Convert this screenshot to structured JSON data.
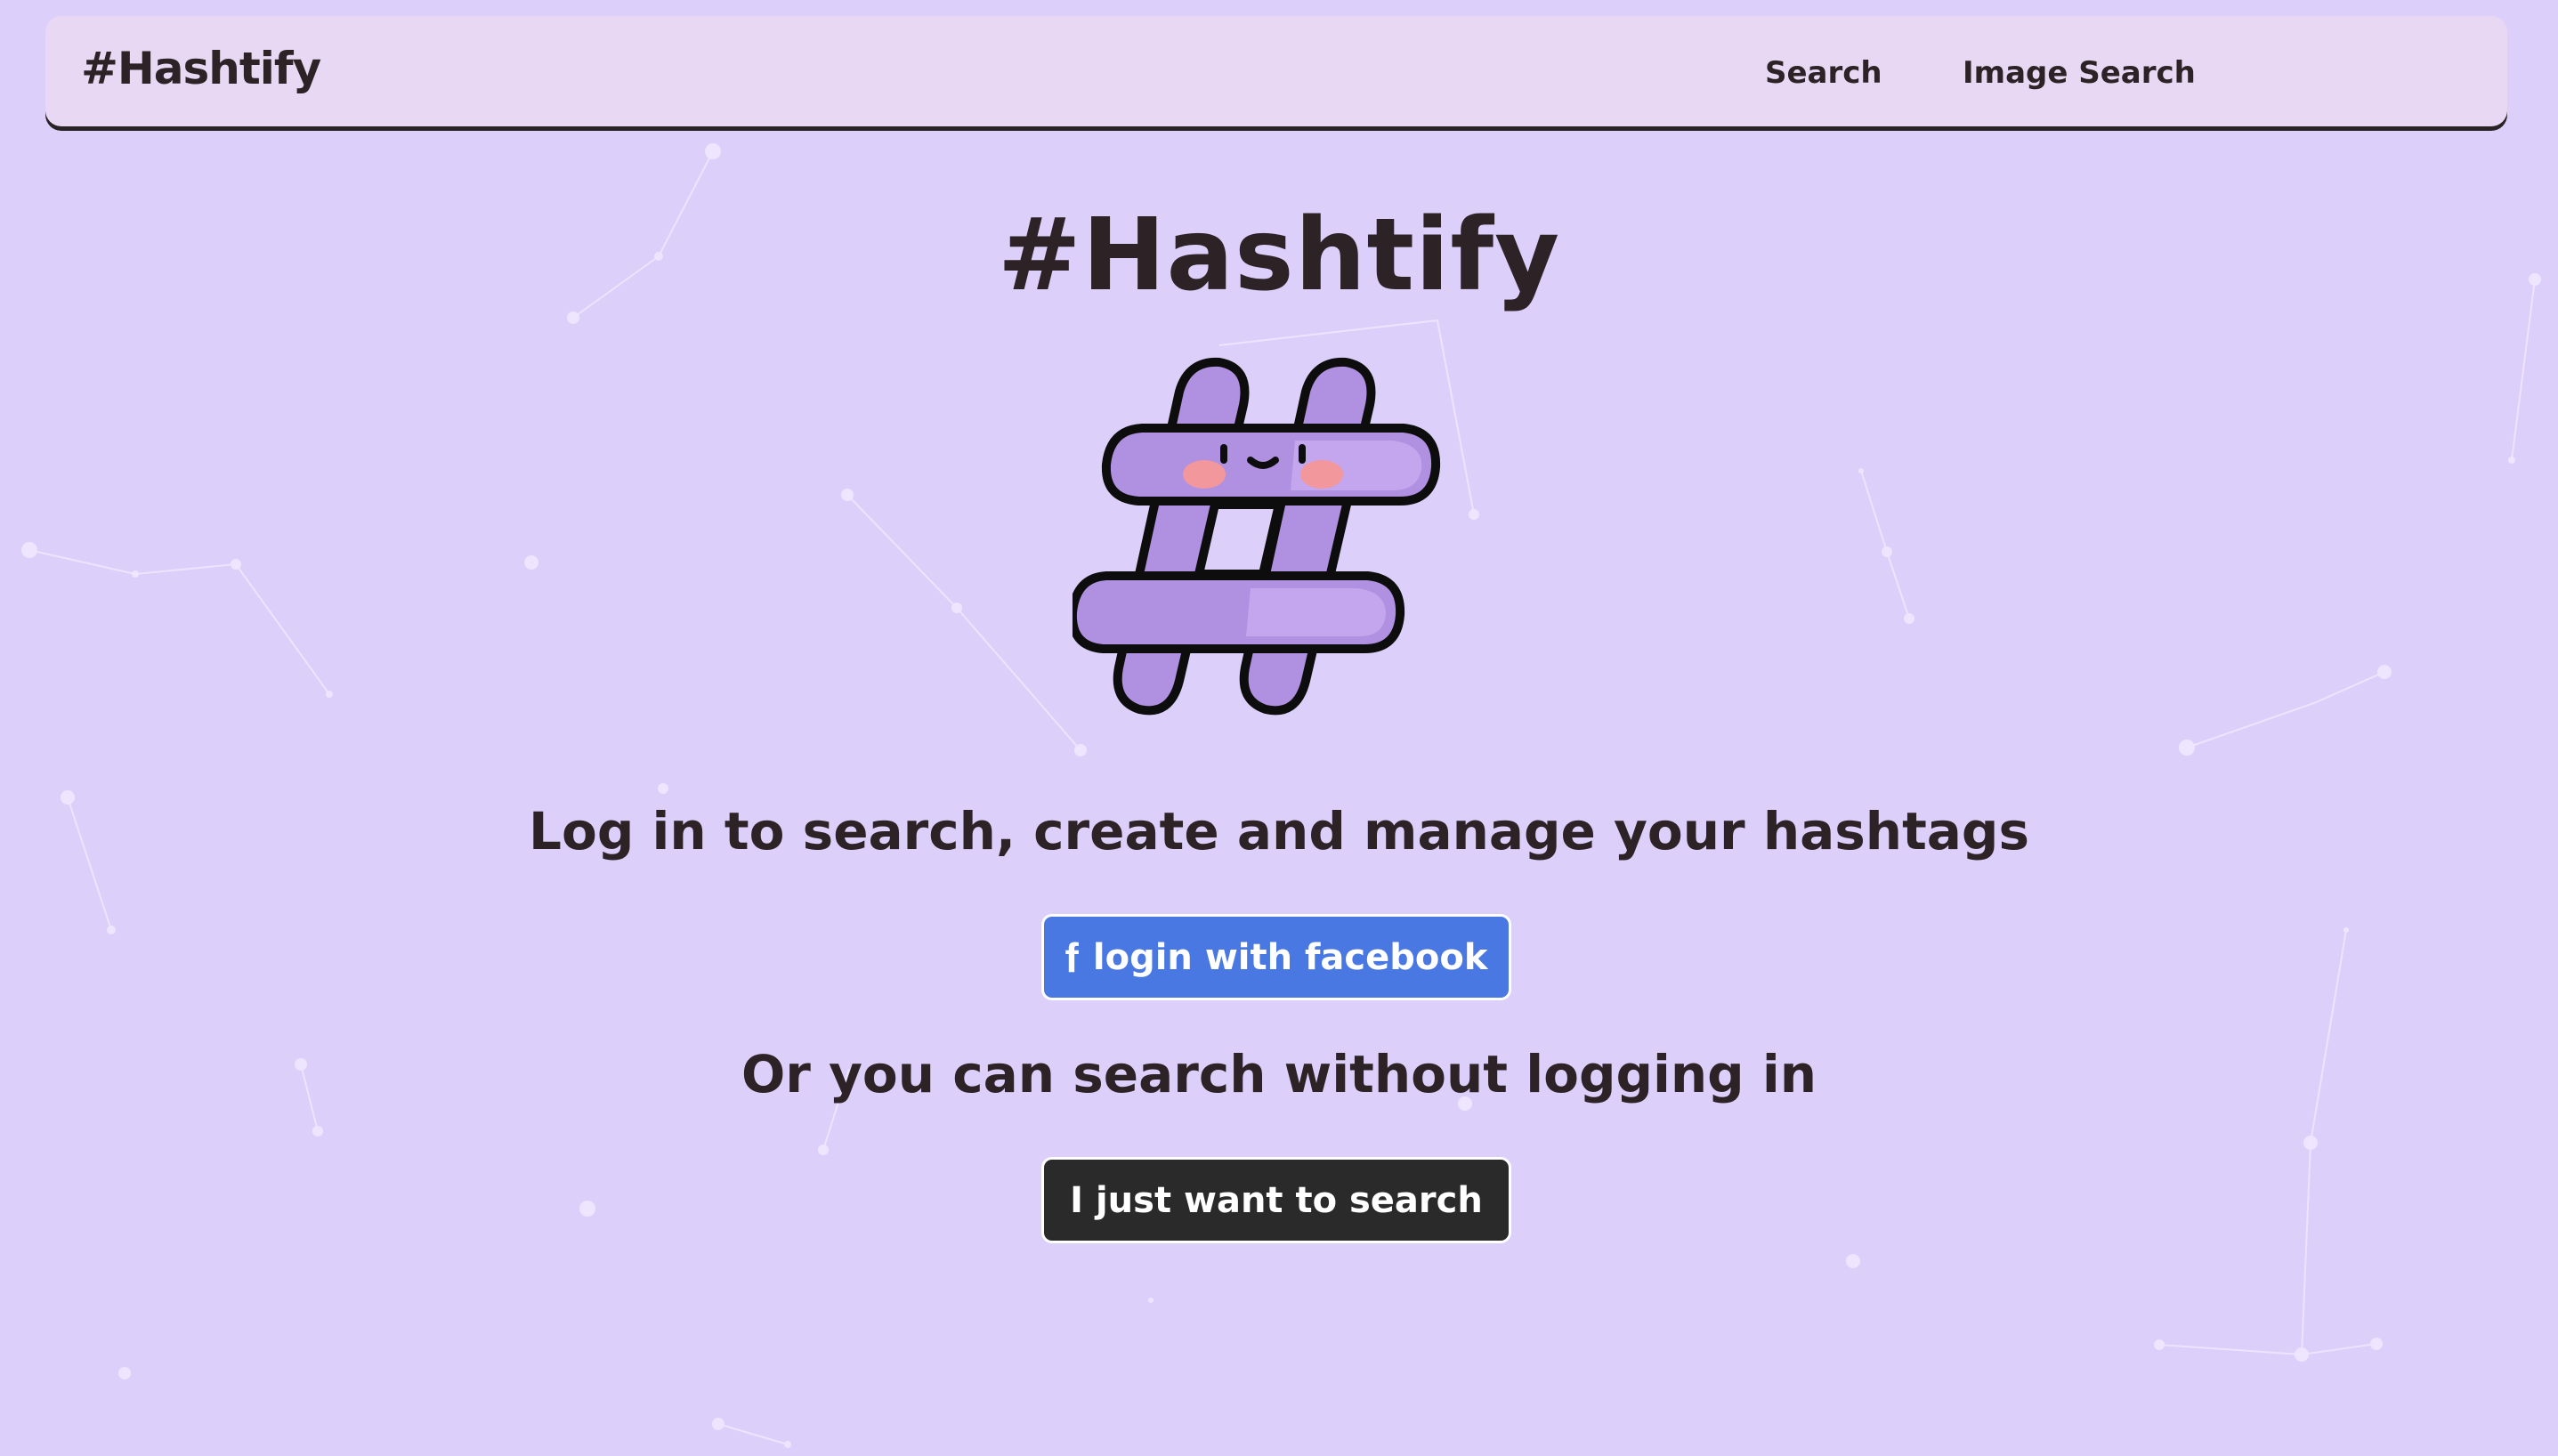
{
  "app": {
    "brand": "#Hashtify",
    "colors": {
      "background": "#dcd0fb",
      "navbar": "#e8d8f3",
      "text": "#2d2327",
      "facebook_button": "#4a78e2",
      "search_button": "#2b2a2a",
      "mascot_fill": "#b090e0"
    }
  },
  "nav": {
    "links": [
      {
        "label": "Search"
      },
      {
        "label": "Image Search"
      }
    ]
  },
  "main": {
    "title": "#Hashtify",
    "mascot_icon": "hashtag-mascot-icon",
    "login_prompt": "Log in to search, create and manage your hashtags",
    "facebook_button": {
      "icon": "facebook-icon",
      "label": "login with facebook"
    },
    "alt_prompt": "Or you can search without logging in",
    "search_button": {
      "label": "I just want to search"
    }
  }
}
